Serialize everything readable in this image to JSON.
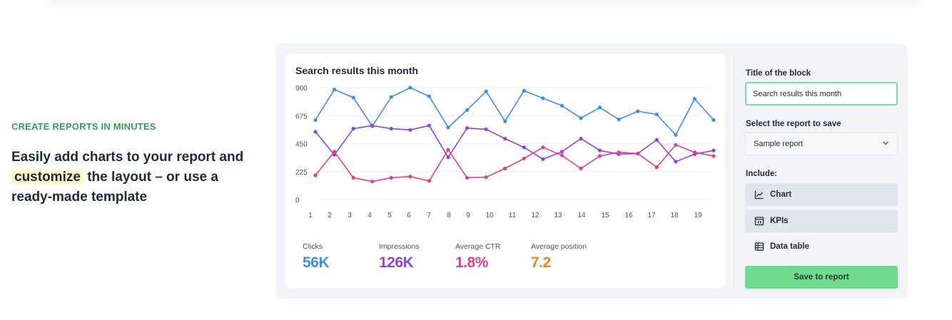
{
  "intro": {
    "eyebrow": "CREATE REPORTS IN MINUTES",
    "headline_part1": "Easily add charts to your report and",
    "headline_highlight": "customize",
    "headline_part2": "the layout – or use a ready-made template"
  },
  "chart_title": "Search results this month",
  "chart_data": {
    "type": "line",
    "x": [
      1,
      2,
      3,
      4,
      5,
      6,
      7,
      8,
      9,
      10,
      11,
      12,
      13,
      14,
      15,
      16,
      17,
      18,
      19,
      20
    ],
    "x_tick_labels": [
      "1",
      "2",
      "3",
      "4",
      "5",
      "6",
      "7",
      "8",
      "9",
      "10",
      "11",
      "12",
      "13",
      "14",
      "15",
      "16",
      "17",
      "18",
      "19"
    ],
    "y_tick_labels": [
      "900",
      "675",
      "450",
      "225",
      "0"
    ],
    "ylim": [
      0,
      900
    ],
    "grid": true,
    "series": [
      {
        "color": "#3f8fd9",
        "values": [
          640,
          885,
          820,
          590,
          825,
          900,
          830,
          580,
          720,
          870,
          630,
          875,
          815,
          755,
          655,
          740,
          645,
          710,
          685,
          520,
          810,
          640
        ]
      },
      {
        "color": "#8e44d8",
        "values": [
          545,
          360,
          570,
          595,
          570,
          560,
          595,
          340,
          575,
          565,
          490,
          420,
          325,
          385,
          490,
          395,
          365,
          370,
          480,
          305,
          365,
          395
        ]
      },
      {
        "color": "#d9418a",
        "values": [
          195,
          385,
          175,
          145,
          175,
          185,
          150,
          400,
          175,
          180,
          250,
          330,
          420,
          355,
          250,
          350,
          380,
          370,
          260,
          440,
          380,
          350
        ]
      }
    ]
  },
  "kpis": [
    {
      "label": "Clicks",
      "value": "56K",
      "color": "#3f8fd9"
    },
    {
      "label": "Impressions",
      "value": "126K",
      "color": "#8e44d8"
    },
    {
      "label": "Average CTR",
      "value": "1.8%",
      "color": "#d9418a"
    },
    {
      "label": "Average position",
      "value": "7.2",
      "color": "#e08a2e"
    }
  ],
  "side": {
    "title_label": "Title of the block",
    "title_value": "Search results this month",
    "report_label": "Select the report to save",
    "report_selected": "Sample report",
    "include_label": "Include:",
    "options": [
      {
        "label": "Chart",
        "icon": "line-chart-icon"
      },
      {
        "label": "KPIs",
        "icon": "calendar-icon"
      },
      {
        "label": "Data table",
        "icon": "table-icon"
      }
    ],
    "save_label": "Save to report"
  }
}
